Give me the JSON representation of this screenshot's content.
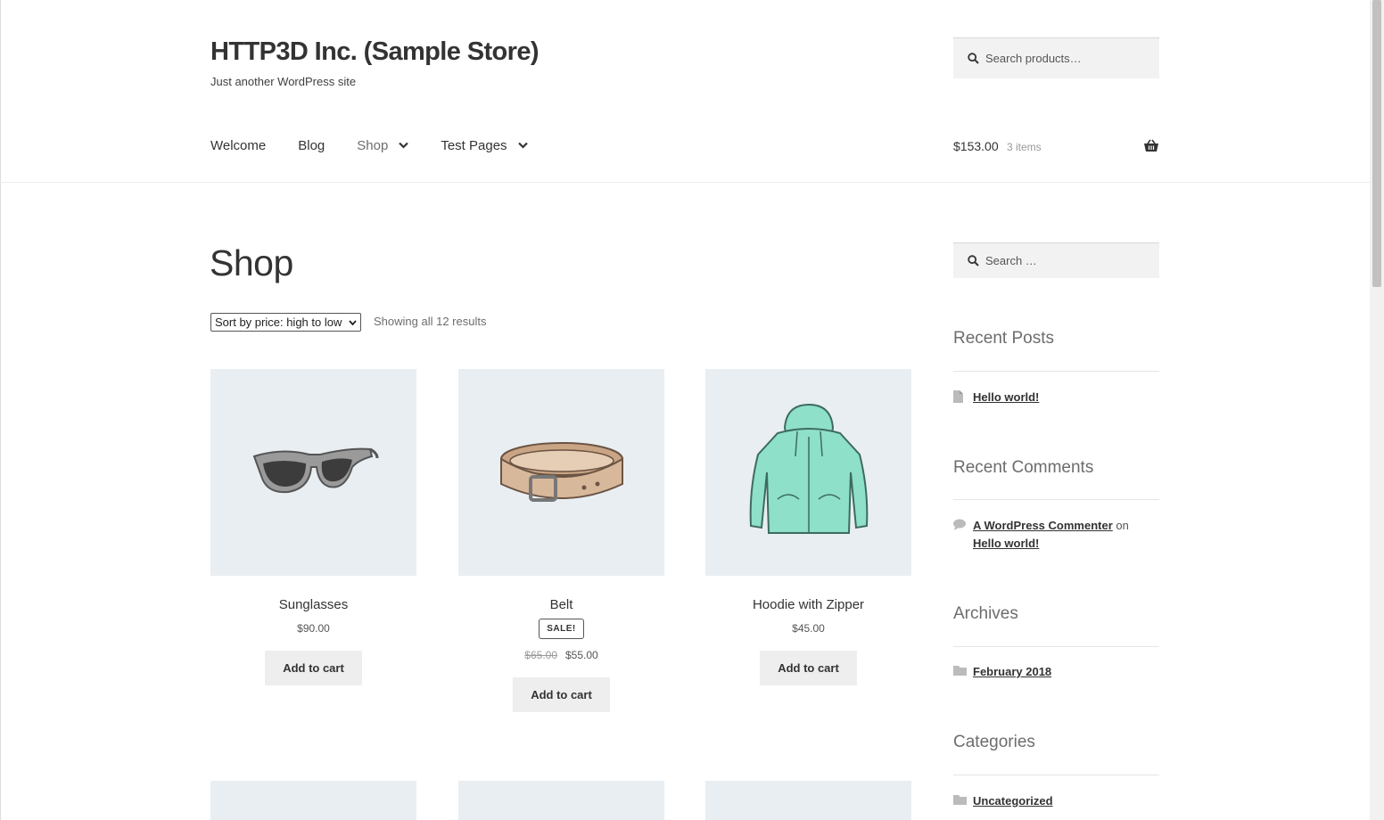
{
  "header": {
    "site_title": "HTTP3D Inc. (Sample Store)",
    "site_description": "Just another WordPress site",
    "search_placeholder": "Search products…"
  },
  "nav": [
    {
      "label": "Welcome",
      "has_dropdown": false
    },
    {
      "label": "Blog",
      "has_dropdown": false
    },
    {
      "label": "Shop",
      "has_dropdown": true
    },
    {
      "label": "Test Pages",
      "has_dropdown": true
    }
  ],
  "cart": {
    "amount": "$153.00",
    "count": "3 items",
    "icon": "basket-icon"
  },
  "main": {
    "page_title": "Shop",
    "sort_selected": "Sort by price: high to low",
    "result_count": "Showing all 12 results"
  },
  "products": [
    {
      "name": "Sunglasses",
      "price": "$90.00",
      "button": "Add to cart"
    },
    {
      "name": "Belt",
      "sale_badge": "SALE!",
      "old_price": "$65.00",
      "price": "$55.00",
      "button": "Add to cart"
    },
    {
      "name": "Hoodie with Zipper",
      "price": "$45.00",
      "button": "Add to cart"
    }
  ],
  "sidebar": {
    "search_placeholder": "Search …",
    "recent_posts_title": "Recent Posts",
    "recent_post": "Hello world!",
    "recent_comments_title": "Recent Comments",
    "comment_author": "A WordPress Commenter",
    "comment_on": "on",
    "comment_post": "Hello world!",
    "archives_title": "Archives",
    "archive_item": "February 2018",
    "categories_title": "Categories",
    "category_item": "Uncategorized"
  },
  "colors": {
    "product_bg": "#e9eef2",
    "button_bg": "#eeeeee",
    "hoodie": "#8ee0c8",
    "belt": "#d8b89a"
  }
}
